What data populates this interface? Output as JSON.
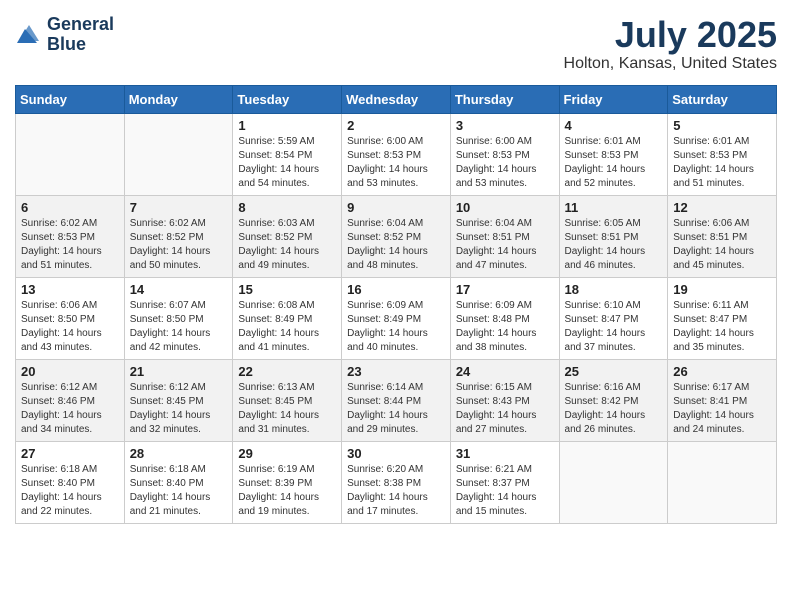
{
  "header": {
    "logo_line1": "General",
    "logo_line2": "Blue",
    "month": "July 2025",
    "location": "Holton, Kansas, United States"
  },
  "weekdays": [
    "Sunday",
    "Monday",
    "Tuesday",
    "Wednesday",
    "Thursday",
    "Friday",
    "Saturday"
  ],
  "weeks": [
    [
      {
        "day": "",
        "info": ""
      },
      {
        "day": "",
        "info": ""
      },
      {
        "day": "1",
        "info": "Sunrise: 5:59 AM\nSunset: 8:54 PM\nDaylight: 14 hours\nand 54 minutes."
      },
      {
        "day": "2",
        "info": "Sunrise: 6:00 AM\nSunset: 8:53 PM\nDaylight: 14 hours\nand 53 minutes."
      },
      {
        "day": "3",
        "info": "Sunrise: 6:00 AM\nSunset: 8:53 PM\nDaylight: 14 hours\nand 53 minutes."
      },
      {
        "day": "4",
        "info": "Sunrise: 6:01 AM\nSunset: 8:53 PM\nDaylight: 14 hours\nand 52 minutes."
      },
      {
        "day": "5",
        "info": "Sunrise: 6:01 AM\nSunset: 8:53 PM\nDaylight: 14 hours\nand 51 minutes."
      }
    ],
    [
      {
        "day": "6",
        "info": "Sunrise: 6:02 AM\nSunset: 8:53 PM\nDaylight: 14 hours\nand 51 minutes."
      },
      {
        "day": "7",
        "info": "Sunrise: 6:02 AM\nSunset: 8:52 PM\nDaylight: 14 hours\nand 50 minutes."
      },
      {
        "day": "8",
        "info": "Sunrise: 6:03 AM\nSunset: 8:52 PM\nDaylight: 14 hours\nand 49 minutes."
      },
      {
        "day": "9",
        "info": "Sunrise: 6:04 AM\nSunset: 8:52 PM\nDaylight: 14 hours\nand 48 minutes."
      },
      {
        "day": "10",
        "info": "Sunrise: 6:04 AM\nSunset: 8:51 PM\nDaylight: 14 hours\nand 47 minutes."
      },
      {
        "day": "11",
        "info": "Sunrise: 6:05 AM\nSunset: 8:51 PM\nDaylight: 14 hours\nand 46 minutes."
      },
      {
        "day": "12",
        "info": "Sunrise: 6:06 AM\nSunset: 8:51 PM\nDaylight: 14 hours\nand 45 minutes."
      }
    ],
    [
      {
        "day": "13",
        "info": "Sunrise: 6:06 AM\nSunset: 8:50 PM\nDaylight: 14 hours\nand 43 minutes."
      },
      {
        "day": "14",
        "info": "Sunrise: 6:07 AM\nSunset: 8:50 PM\nDaylight: 14 hours\nand 42 minutes."
      },
      {
        "day": "15",
        "info": "Sunrise: 6:08 AM\nSunset: 8:49 PM\nDaylight: 14 hours\nand 41 minutes."
      },
      {
        "day": "16",
        "info": "Sunrise: 6:09 AM\nSunset: 8:49 PM\nDaylight: 14 hours\nand 40 minutes."
      },
      {
        "day": "17",
        "info": "Sunrise: 6:09 AM\nSunset: 8:48 PM\nDaylight: 14 hours\nand 38 minutes."
      },
      {
        "day": "18",
        "info": "Sunrise: 6:10 AM\nSunset: 8:47 PM\nDaylight: 14 hours\nand 37 minutes."
      },
      {
        "day": "19",
        "info": "Sunrise: 6:11 AM\nSunset: 8:47 PM\nDaylight: 14 hours\nand 35 minutes."
      }
    ],
    [
      {
        "day": "20",
        "info": "Sunrise: 6:12 AM\nSunset: 8:46 PM\nDaylight: 14 hours\nand 34 minutes."
      },
      {
        "day": "21",
        "info": "Sunrise: 6:12 AM\nSunset: 8:45 PM\nDaylight: 14 hours\nand 32 minutes."
      },
      {
        "day": "22",
        "info": "Sunrise: 6:13 AM\nSunset: 8:45 PM\nDaylight: 14 hours\nand 31 minutes."
      },
      {
        "day": "23",
        "info": "Sunrise: 6:14 AM\nSunset: 8:44 PM\nDaylight: 14 hours\nand 29 minutes."
      },
      {
        "day": "24",
        "info": "Sunrise: 6:15 AM\nSunset: 8:43 PM\nDaylight: 14 hours\nand 27 minutes."
      },
      {
        "day": "25",
        "info": "Sunrise: 6:16 AM\nSunset: 8:42 PM\nDaylight: 14 hours\nand 26 minutes."
      },
      {
        "day": "26",
        "info": "Sunrise: 6:17 AM\nSunset: 8:41 PM\nDaylight: 14 hours\nand 24 minutes."
      }
    ],
    [
      {
        "day": "27",
        "info": "Sunrise: 6:18 AM\nSunset: 8:40 PM\nDaylight: 14 hours\nand 22 minutes."
      },
      {
        "day": "28",
        "info": "Sunrise: 6:18 AM\nSunset: 8:40 PM\nDaylight: 14 hours\nand 21 minutes."
      },
      {
        "day": "29",
        "info": "Sunrise: 6:19 AM\nSunset: 8:39 PM\nDaylight: 14 hours\nand 19 minutes."
      },
      {
        "day": "30",
        "info": "Sunrise: 6:20 AM\nSunset: 8:38 PM\nDaylight: 14 hours\nand 17 minutes."
      },
      {
        "day": "31",
        "info": "Sunrise: 6:21 AM\nSunset: 8:37 PM\nDaylight: 14 hours\nand 15 minutes."
      },
      {
        "day": "",
        "info": ""
      },
      {
        "day": "",
        "info": ""
      }
    ]
  ]
}
